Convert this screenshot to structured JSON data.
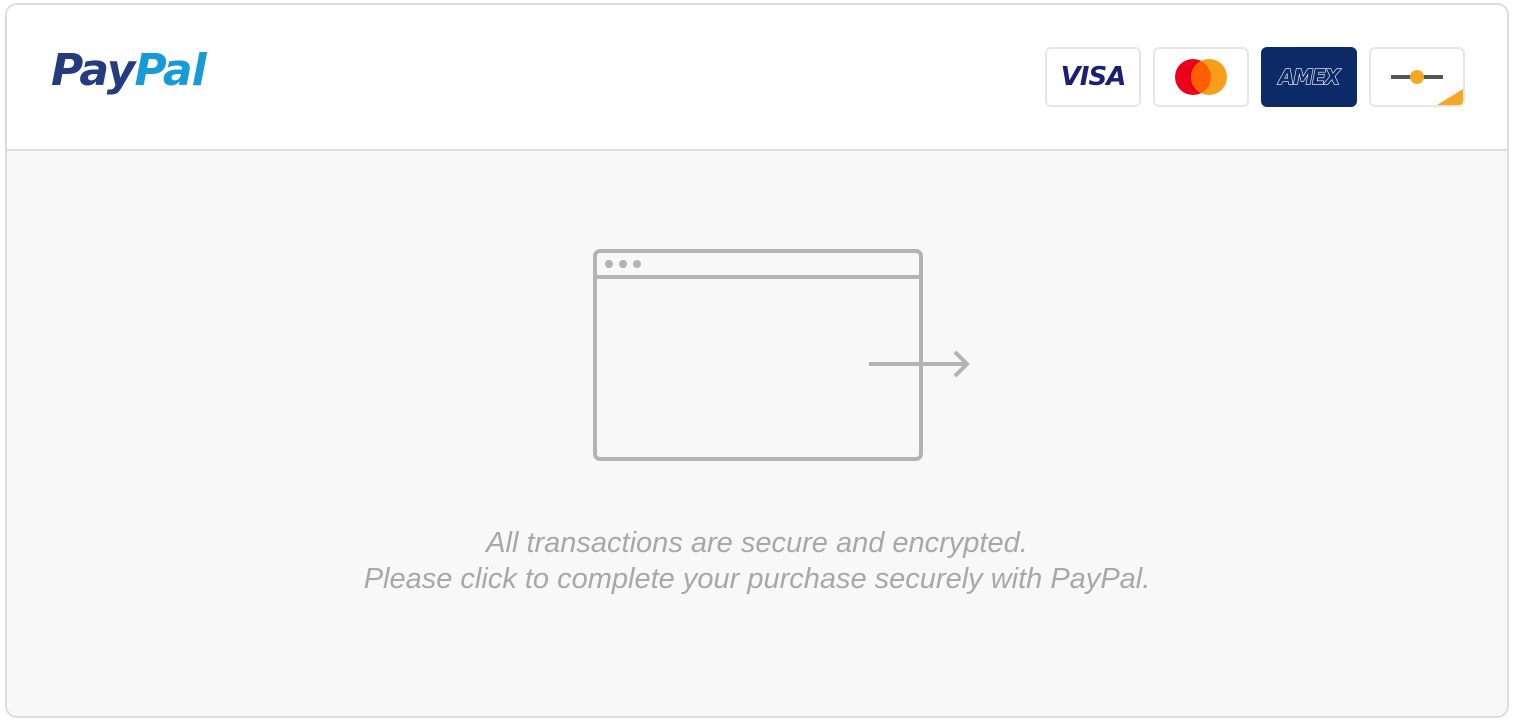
{
  "header": {
    "logo": {
      "part1": "Pay",
      "part2": "Pal",
      "colors": {
        "part1": "#253b80",
        "part2": "#179bd7"
      }
    },
    "payment_methods": [
      {
        "icon": "visa-icon",
        "label": "VISA"
      },
      {
        "icon": "mastercard-icon",
        "colors": [
          "#eb001b",
          "#f79e1b"
        ]
      },
      {
        "icon": "amex-icon",
        "label": "AMEX",
        "background": "#0c2a67"
      },
      {
        "icon": "generic-card-icon",
        "accent": "#f5a623"
      }
    ]
  },
  "main": {
    "illustration_icon": "browser-redirect-icon",
    "message_line1": "All transactions are secure and encrypted.",
    "message_line2": "Please click to complete your purchase securely with PayPal."
  },
  "colors": {
    "border": "#dcdcdc",
    "content_background": "#f8f8f8",
    "muted_text": "#a8a8a8",
    "icon_stroke": "#b3b3b3"
  }
}
